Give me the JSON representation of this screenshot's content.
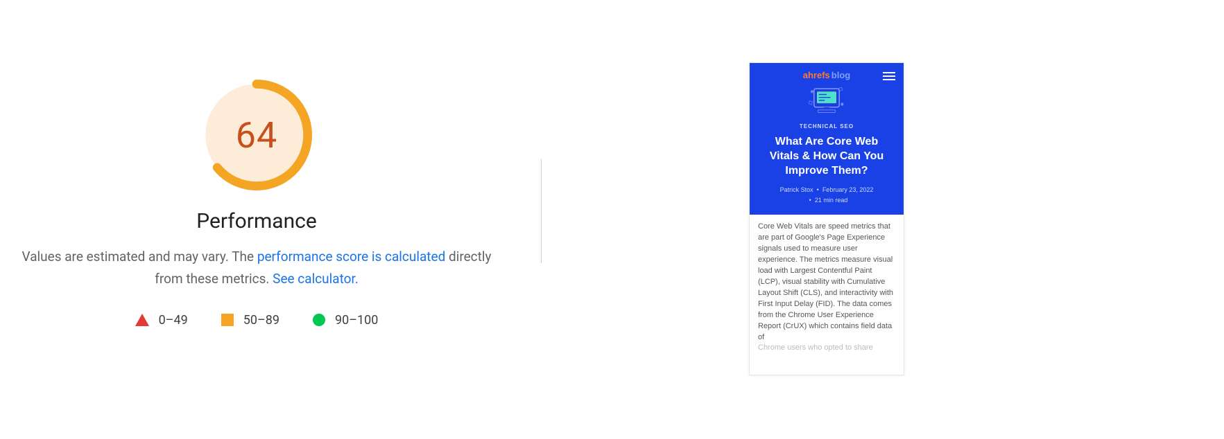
{
  "performance": {
    "score": "64",
    "title": "Performance",
    "desc_prefix": "Values are estimated and may vary. The ",
    "desc_link1": "performance score is calculated",
    "desc_middle": " directly from these metrics. ",
    "desc_link2": "See calculator.",
    "legend": {
      "red": "0–49",
      "amber": "50–89",
      "green": "90–100"
    },
    "gauge": {
      "color_fg": "#f5a524",
      "color_bg": "#fdecd8",
      "fraction": 0.64
    }
  },
  "preview": {
    "logo_brand": "ahrefs",
    "logo_section": "blog",
    "category": "TECHNICAL SEO",
    "headline": "What Are Core Web Vitals & How Can You Improve Them?",
    "author": "Patrick Stox",
    "date": "February 23, 2022",
    "read_time": "21 min read",
    "body": "Core Web Vitals are speed metrics that are part of Google's Page Experience signals used to measure user experience. The metrics measure visual load with Largest Contentful Paint (LCP), visual stability with Cumulative Layout Shift (CLS), and interactivity with First Input Delay (FID). The data comes from the Chrome User Experience Report (CrUX) which contains field data of",
    "body_fade": "Chrome users who opted to share"
  }
}
